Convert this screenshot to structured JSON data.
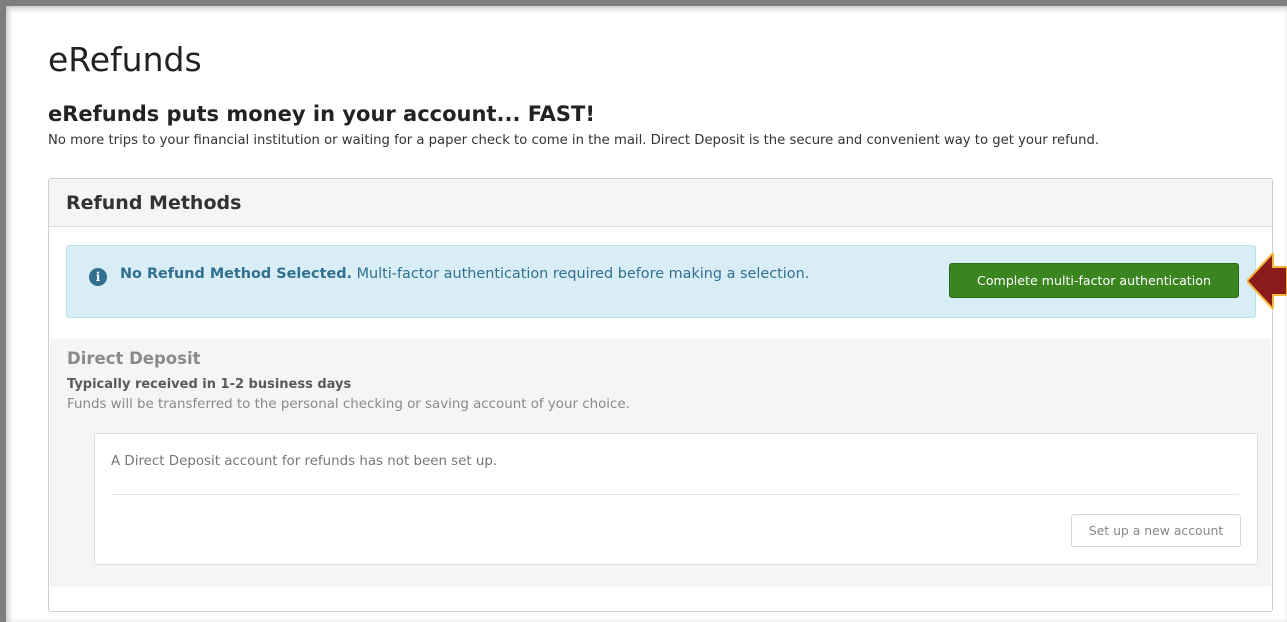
{
  "page": {
    "title": "eRefunds",
    "subtitle": "eRefunds puts money in your account... FAST!",
    "intro": "No more trips to your financial institution or waiting for a paper check to come in the mail. Direct Deposit is the secure and convenient way to get your refund."
  },
  "panel": {
    "title": "Refund Methods",
    "alert": {
      "icon": "info-icon",
      "strong": "No Refund Method Selected.",
      "message": " Multi-factor authentication required before making a selection.",
      "button_label": "Complete multi-factor authentication"
    },
    "direct_deposit": {
      "title": "Direct Deposit",
      "subtitle": "Typically received in 1-2 business days",
      "description": "Funds will be transferred to the personal checking or saving account of your choice.",
      "empty_message": "A Direct Deposit account for refunds has not been set up.",
      "setup_button_label": "Set up a new account"
    }
  },
  "colors": {
    "alert_bg": "#d9edf7",
    "alert_text": "#31708f",
    "primary_button": "#3b8521",
    "annotation_arrow": "#8b1a1a"
  }
}
